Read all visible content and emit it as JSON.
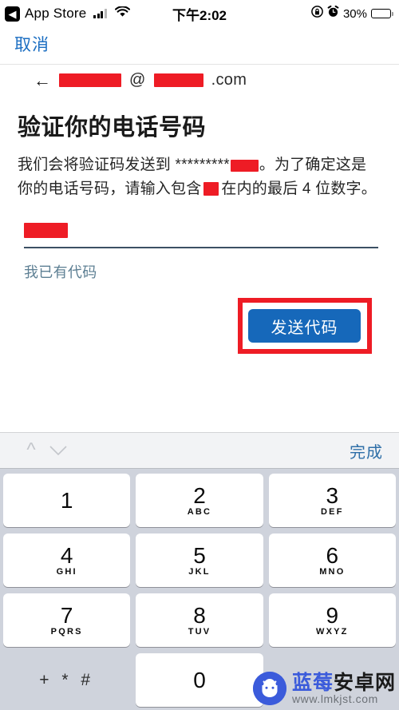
{
  "status_bar": {
    "back_label": "App Store",
    "back_icon": "chevron-left-icon",
    "signal_icon": "cellular-signal-icon",
    "wifi_icon": "wifi-icon",
    "time": "下午2:02",
    "rotation_lock_icon": "rotation-lock-icon",
    "alarm_icon": "alarm-clock-icon",
    "battery_percent": "30%",
    "battery_level": 30
  },
  "nav": {
    "cancel_label": "取消",
    "back_arrow": "←",
    "email_suffix": ".com",
    "email_at": "@",
    "email_redacted": true
  },
  "main": {
    "title": "验证你的电话号码",
    "body_part1": "我们会将验证码发送到 *********",
    "body_part2": "。为了确定这是你的电话号码，请输入包含",
    "body_part3": "在内的最后 4 位数字。",
    "input_value_redacted": true,
    "input_placeholder": "",
    "have_code_link": "我已有代码",
    "send_code_label": "发送代码",
    "accent_blue": "#1668ba",
    "highlight_red": "#ee1c25",
    "link_blue": "#5d7f93",
    "cancel_blue": "#1b6ec2",
    "field_line_color": "#3c5064"
  },
  "keyboard": {
    "prev_icon": "chevron-up-icon",
    "next_icon": "chevron-down-icon",
    "done_label": "完成",
    "keys": [
      {
        "num": "1",
        "sub": ""
      },
      {
        "num": "2",
        "sub": "ABC"
      },
      {
        "num": "3",
        "sub": "DEF"
      },
      {
        "num": "4",
        "sub": "GHI"
      },
      {
        "num": "5",
        "sub": "JKL"
      },
      {
        "num": "6",
        "sub": "MNO"
      },
      {
        "num": "7",
        "sub": "PQRS"
      },
      {
        "num": "8",
        "sub": "TUV"
      },
      {
        "num": "9",
        "sub": "WXYZ"
      },
      {
        "num": "+ * #",
        "sub": ""
      },
      {
        "num": "0",
        "sub": ""
      },
      {
        "num": "",
        "sub": ""
      }
    ]
  },
  "watermark": {
    "title_blue": "蓝莓",
    "title_dark": "安卓网",
    "url": "www.lmkjst.com",
    "logo_icon": "android-robot-icon",
    "logo_color": "#3b5bdb"
  }
}
